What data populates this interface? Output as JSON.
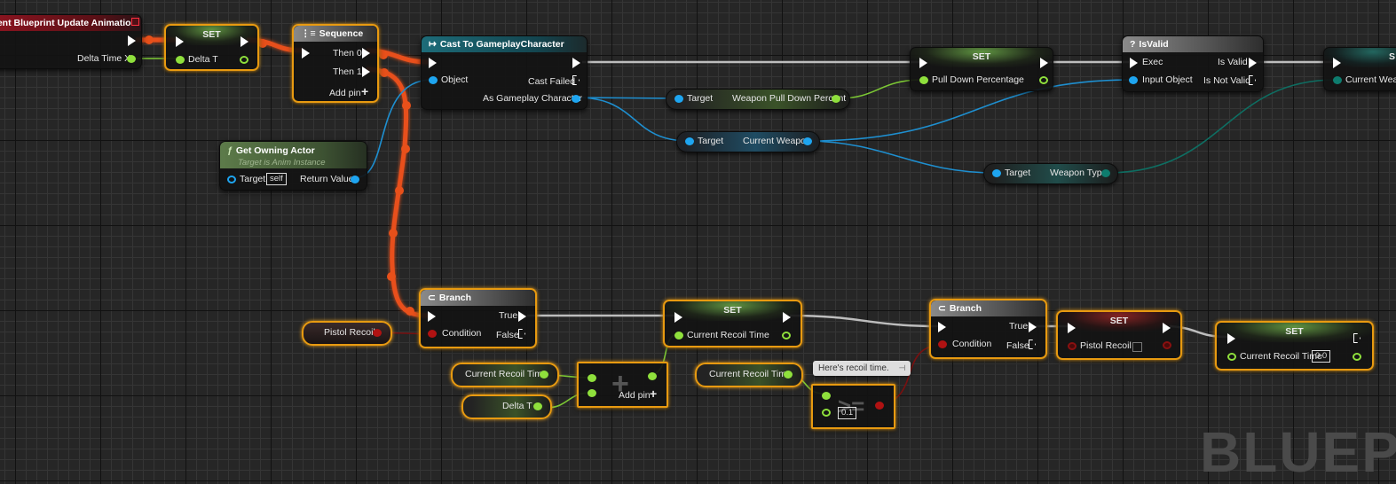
{
  "watermark": "BLUEPRINT",
  "colors": {
    "exec_wire": "#e8501a",
    "exec_plain": "#c8c8c8",
    "float": "#8fe03c",
    "object": "#1ea5f0",
    "enum": "#0e7c6e",
    "bool": "#8a1010",
    "selection": "#e89a10"
  },
  "nodes": {
    "event_update": {
      "title": "Event Blueprint Update Animation",
      "title_visible": "vent Blueprint Update Animation",
      "out_pin": "Delta Time X"
    },
    "set_delta": {
      "title": "SET",
      "in_pin": "Delta T"
    },
    "sequence": {
      "title": "Sequence",
      "pins": [
        "Then 0",
        "Then 1"
      ],
      "add_pin": "Add pin"
    },
    "cast": {
      "title": "Cast To GameplayCharacter",
      "in_pin": "Object",
      "cast_failed": "Cast Failed",
      "out_pin": "As Gameplay Character"
    },
    "get_owning_actor": {
      "title": "Get Owning Actor",
      "subtitle": "Target is Anim Instance",
      "target_label": "Target",
      "target_default": "self",
      "out_pin": "Return Value"
    },
    "weapon_pull_down": {
      "target": "Target",
      "out": "Weapon Pull Down Percent"
    },
    "current_weapon_get": {
      "target": "Target",
      "out": "Current Weapon"
    },
    "weapon_type_get": {
      "target": "Target",
      "out": "Weapon Type"
    },
    "set_pulldown": {
      "title": "SET",
      "in_pin": "Pull Down Percentage"
    },
    "is_valid": {
      "title": "IsValid",
      "exec": "Exec",
      "input": "Input Object",
      "is_valid": "Is Valid",
      "is_not_valid": "Is Not Valid"
    },
    "set_weapon_type": {
      "title": "S",
      "in_pin": "Current Weap"
    },
    "branch1": {
      "title": "Branch",
      "condition": "Condition",
      "true": "True",
      "false": "False"
    },
    "pistol_recoil_get": {
      "label": "Pistol Recoil"
    },
    "set_recoil_time": {
      "title": "SET",
      "in_pin": "Current Recoil Time"
    },
    "recoil_time_get1": {
      "label": "Current Recoil Time"
    },
    "delta_t_get": {
      "label": "Delta T"
    },
    "add_node": {
      "symbol": "+",
      "add_pin": "Add pin"
    },
    "recoil_time_get2": {
      "label": "Current Recoil Time"
    },
    "compare": {
      "symbol": ">=",
      "default_value": "0.1",
      "comment": "Here's recoil time."
    },
    "branch2": {
      "title": "Branch",
      "condition": "Condition",
      "true": "True",
      "false": "False"
    },
    "set_pistol_recoil": {
      "title": "SET",
      "in_pin": "Pistol Recoil",
      "checked": false
    },
    "set_recoil_reset": {
      "title": "SET",
      "in_pin": "Current Recoil Time",
      "default_value": "0.0"
    }
  }
}
